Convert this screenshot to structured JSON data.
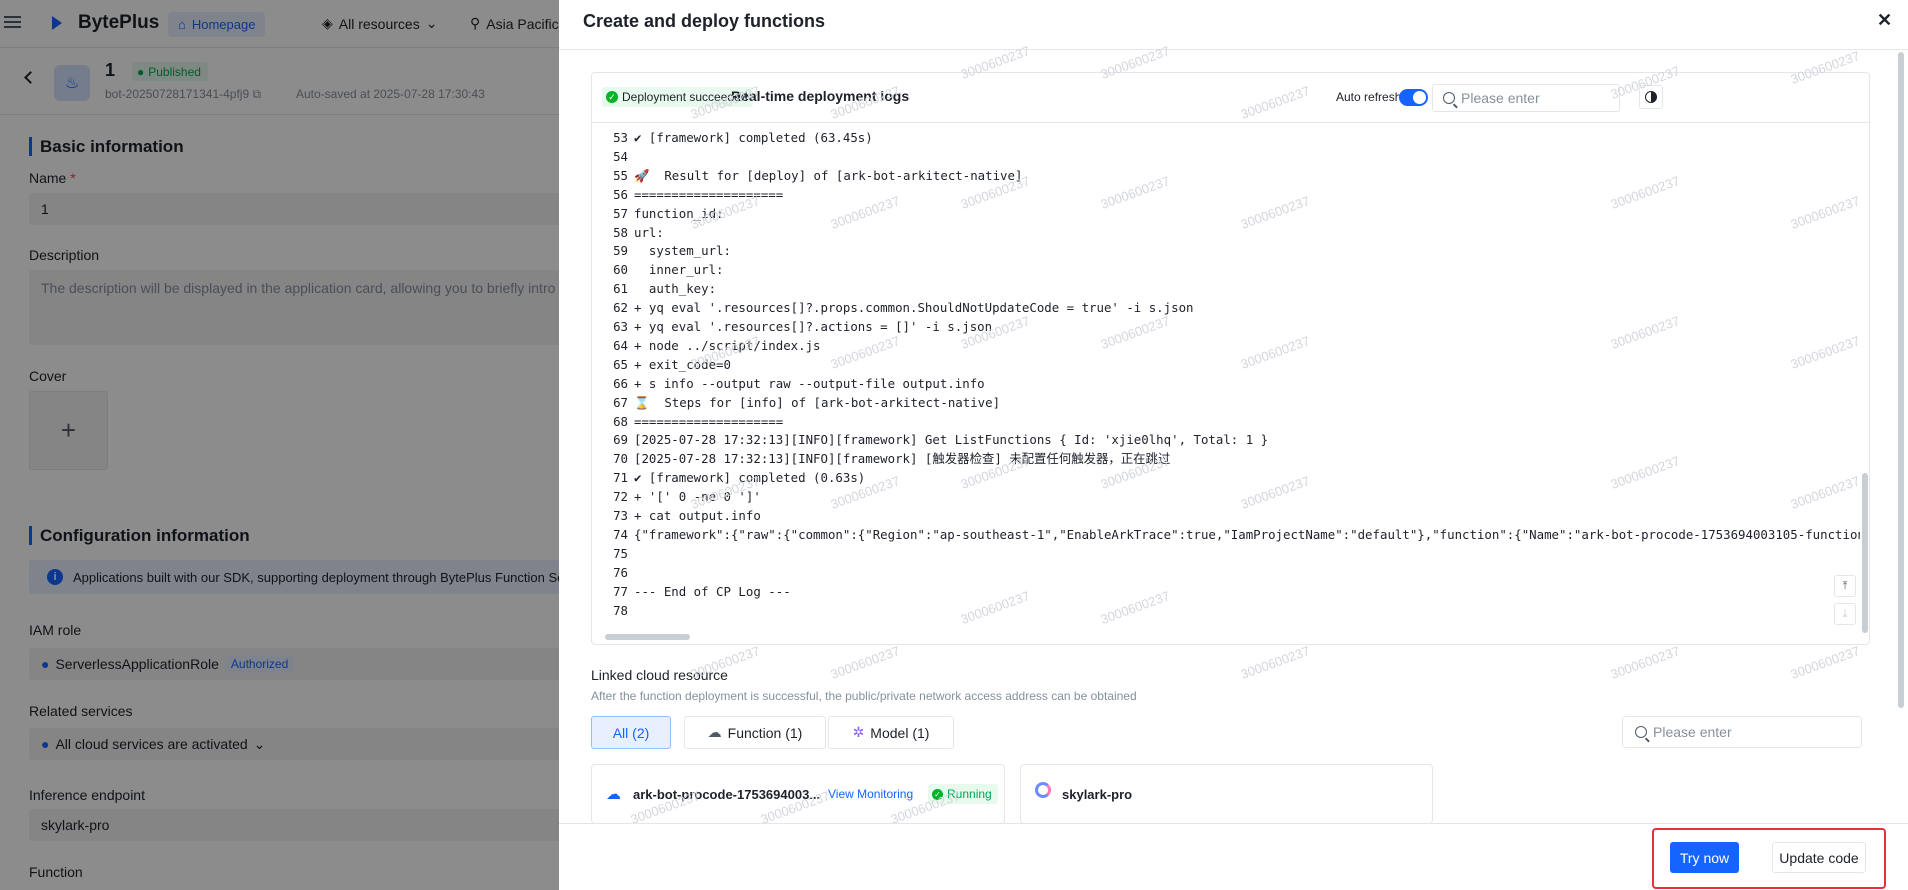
{
  "topbar": {
    "brand": "BytePlus",
    "home_label": "Homepage",
    "resources_label": "All resources",
    "region_label": "Asia Pacific"
  },
  "app": {
    "name": "1",
    "status": "Published",
    "bot_id": "bot-20250728171341-4pfj9",
    "autosave": "Auto-saved at 2025-07-28 17:30:43"
  },
  "form": {
    "basic_title": "Basic information",
    "name_label": "Name",
    "name_value": "1",
    "desc_label": "Description",
    "desc_placeholder": "The description will be displayed in the application card, allowing you to briefly intro",
    "cover_label": "Cover",
    "config_title": "Configuration information",
    "info_text": "Applications built with our SDK, supporting deployment through BytePlus Function Se",
    "iam_label": "IAM role",
    "iam_value": "ServerlessApplicationRole",
    "iam_badge": "Authorized",
    "related_label": "Related services",
    "related_value": "All cloud services are activated",
    "endpoint_label": "Inference endpoint",
    "endpoint_value": "skylark-pro",
    "function_label": "Function"
  },
  "drawer": {
    "title": "Create and deploy functions",
    "log": {
      "status_badge": "Deployment succeeded",
      "title": "Real-time deployment logs",
      "auto_refresh_label": "Auto refresh",
      "auto_refresh_on": true,
      "search_placeholder": "Please enter",
      "lines": [
        {
          "n": "53",
          "t": "✔ [framework] completed (63.45s)"
        },
        {
          "n": "54",
          "t": ""
        },
        {
          "n": "55",
          "t": "🚀  Result for [deploy] of [ark-bot-arkitect-native]"
        },
        {
          "n": "56",
          "t": "===================="
        },
        {
          "n": "57",
          "t": "function_id:"
        },
        {
          "n": "58",
          "t": "url:"
        },
        {
          "n": "59",
          "t": "  system_url:"
        },
        {
          "n": "60",
          "t": "  inner_url:"
        },
        {
          "n": "61",
          "t": "  auth_key:"
        },
        {
          "n": "62",
          "t": "+ yq eval '.resources[]?.props.common.ShouldNotUpdateCode = true' -i s.json"
        },
        {
          "n": "63",
          "t": "+ yq eval '.resources[]?.actions = []' -i s.json"
        },
        {
          "n": "64",
          "t": "+ node ../script/index.js"
        },
        {
          "n": "65",
          "t": "+ exit_code=0"
        },
        {
          "n": "66",
          "t": "+ s info --output raw --output-file output.info"
        },
        {
          "n": "67",
          "t": "⌛  Steps for [info] of [ark-bot-arkitect-native]"
        },
        {
          "n": "68",
          "t": "===================="
        },
        {
          "n": "69",
          "t": "[2025-07-28 17:32:13][INFO][framework] Get ListFunctions { Id: 'xjie0lhq', Total: 1 }"
        },
        {
          "n": "70",
          "t": "[2025-07-28 17:32:13][INFO][framework] [触发器检查] 未配置任何触发器，正在跳过"
        },
        {
          "n": "71",
          "t": "✔ [framework] completed (0.63s)"
        },
        {
          "n": "72",
          "t": "+ '[' 0 -ne 0 ']'"
        },
        {
          "n": "73",
          "t": "+ cat output.info"
        },
        {
          "n": "74",
          "t": "{\"framework\":{\"raw\":{\"common\":{\"Region\":\"ap-southeast-1\",\"EnableArkTrace\":true,\"IamProjectName\":\"default\"},\"function\":{\"Name\":\"ark-bot-procode-1753694003105-function\","
        },
        {
          "n": "75",
          "t": ""
        },
        {
          "n": "76",
          "t": ""
        },
        {
          "n": "77",
          "t": "--- End of CP Log ---"
        },
        {
          "n": "78",
          "t": ""
        }
      ]
    },
    "linked": {
      "title": "Linked cloud resource",
      "desc": "After the function deployment is successful, the public/private network access address can be obtained",
      "tabs": [
        {
          "label": "All (2)",
          "active": true
        },
        {
          "label": "Function (1)",
          "active": false
        },
        {
          "label": "Model (1)",
          "active": false
        }
      ],
      "search_placeholder": "Please enter",
      "cards": [
        {
          "name": "ark-bot-procode-1753694003...",
          "link": "View Monitoring",
          "status": "Running"
        },
        {
          "name": "skylark-pro"
        }
      ]
    },
    "footer": {
      "try_label": "Try now",
      "update_label": "Update code"
    }
  },
  "watermark": "3000600237",
  "colors": {
    "accent": "#1664ff",
    "success": "#00b42a",
    "highlight": "#e8303d"
  }
}
